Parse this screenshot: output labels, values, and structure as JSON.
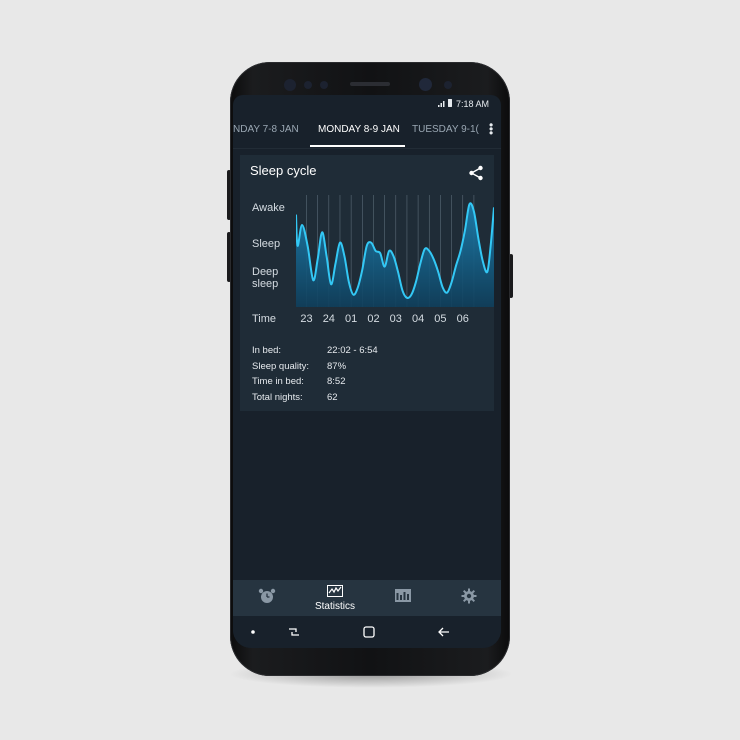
{
  "status_bar": {
    "time": "7:18 AM",
    "signal_icon": "signal-icon",
    "battery_icon": "battery-icon"
  },
  "tabs": [
    {
      "label": "NDAY 7-8 JAN",
      "active": false
    },
    {
      "label": "MONDAY 8-9 JAN",
      "active": true
    },
    {
      "label": "TUESDAY 9-1(",
      "active": false
    }
  ],
  "card": {
    "title": "Sleep cycle",
    "share_icon": "share-icon"
  },
  "chart_data": {
    "type": "area",
    "y_categories": [
      "Awake",
      "Sleep",
      "Deep sleep"
    ],
    "ylabels": {
      "awake": "Awake",
      "sleep": "Sleep",
      "deep_line1": "Deep",
      "deep_line2": "sleep"
    },
    "xlabel": "Time",
    "x_ticks": [
      "23",
      "24",
      "01",
      "02",
      "03",
      "04",
      "05",
      "06"
    ],
    "x": [
      22.03,
      22.1,
      22.3,
      22.55,
      22.8,
      23.0,
      23.2,
      23.4,
      23.6,
      23.8,
      24.0,
      24.2,
      24.4,
      24.6,
      24.8,
      25.0,
      25.2,
      25.4,
      25.6,
      25.8,
      26.0,
      26.2,
      26.4,
      26.6,
      26.8,
      27.0,
      27.2,
      27.4,
      27.6,
      27.8,
      28.0,
      28.2,
      28.4,
      28.6,
      28.8,
      29.0,
      29.2,
      29.4,
      29.6,
      29.8,
      30.0,
      30.2,
      30.4,
      30.6,
      30.75,
      30.9
    ],
    "y": [
      0.85,
      0.55,
      0.75,
      0.55,
      0.22,
      0.42,
      0.68,
      0.45,
      0.18,
      0.38,
      0.58,
      0.45,
      0.2,
      0.08,
      0.15,
      0.32,
      0.55,
      0.58,
      0.5,
      0.48,
      0.35,
      0.5,
      0.45,
      0.3,
      0.12,
      0.05,
      0.08,
      0.2,
      0.38,
      0.52,
      0.5,
      0.42,
      0.3,
      0.15,
      0.1,
      0.2,
      0.36,
      0.5,
      0.7,
      0.95,
      0.88,
      0.62,
      0.4,
      0.3,
      0.55,
      0.92
    ],
    "ylim": [
      0,
      1
    ],
    "xlim": [
      22.03,
      30.9
    ],
    "colors": {
      "line": "#33c8f5",
      "fill_top": "#1c82b3",
      "fill_bottom": "#0f3f5c",
      "grid": "#5b6b78"
    }
  },
  "stats": [
    {
      "key": "In bed:",
      "value": "22:02 - 6:54"
    },
    {
      "key": "Sleep quality:",
      "value": "87%"
    },
    {
      "key": "Time in bed:",
      "value": "8:52"
    },
    {
      "key": "Total nights:",
      "value": "62"
    }
  ],
  "bottom_nav": [
    {
      "icon": "alarm-clock-icon",
      "label": ""
    },
    {
      "icon": "statistics-chart-icon",
      "label": "Statistics"
    },
    {
      "icon": "calendar-icon",
      "label": ""
    },
    {
      "icon": "gear-icon",
      "label": ""
    }
  ],
  "system_nav": [
    "dot-icon",
    "recent-apps-icon",
    "home-icon",
    "back-icon"
  ],
  "colors": {
    "accent": "#33c8f5",
    "background": "#18212b",
    "card": "#1f2c37",
    "nav": "#263440"
  }
}
